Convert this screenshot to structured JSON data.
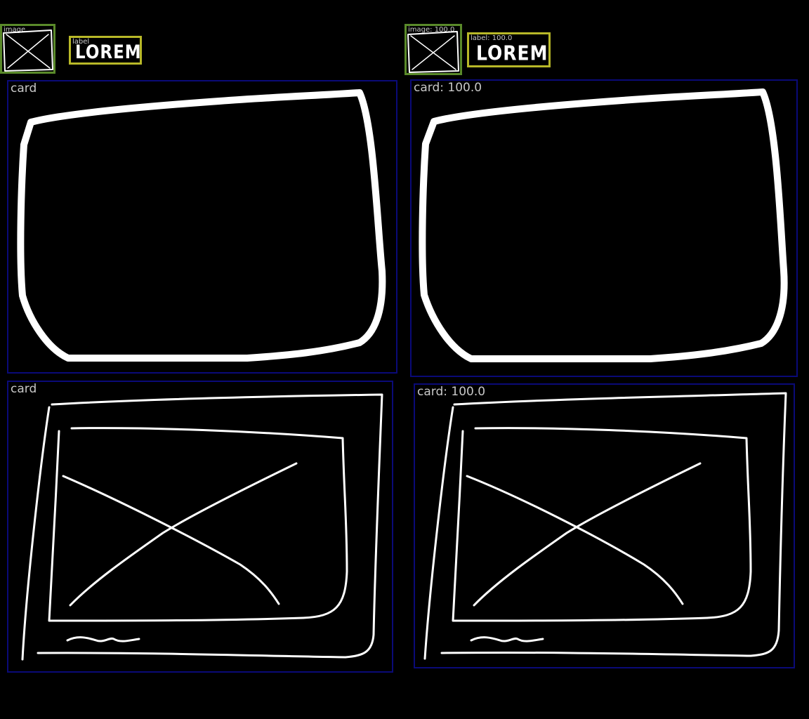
{
  "left": {
    "image_tag": "image",
    "label_tag": "label",
    "label_text": "LOREM",
    "card_top_tag": "card",
    "card_bottom_tag": "card"
  },
  "right": {
    "image_tag": "image: 100.0",
    "label_tag": "label: 100.0",
    "label_text": "LOREM",
    "card_top_tag": "card: 100.0",
    "card_bottom_tag": "card: 100.0"
  },
  "colors": {
    "card_box": "#0a0a78",
    "image_box": "#5a8a2a",
    "label_box": "#b8b828",
    "sketch": "#ffffff",
    "tag_text": "#c8c8c8"
  }
}
